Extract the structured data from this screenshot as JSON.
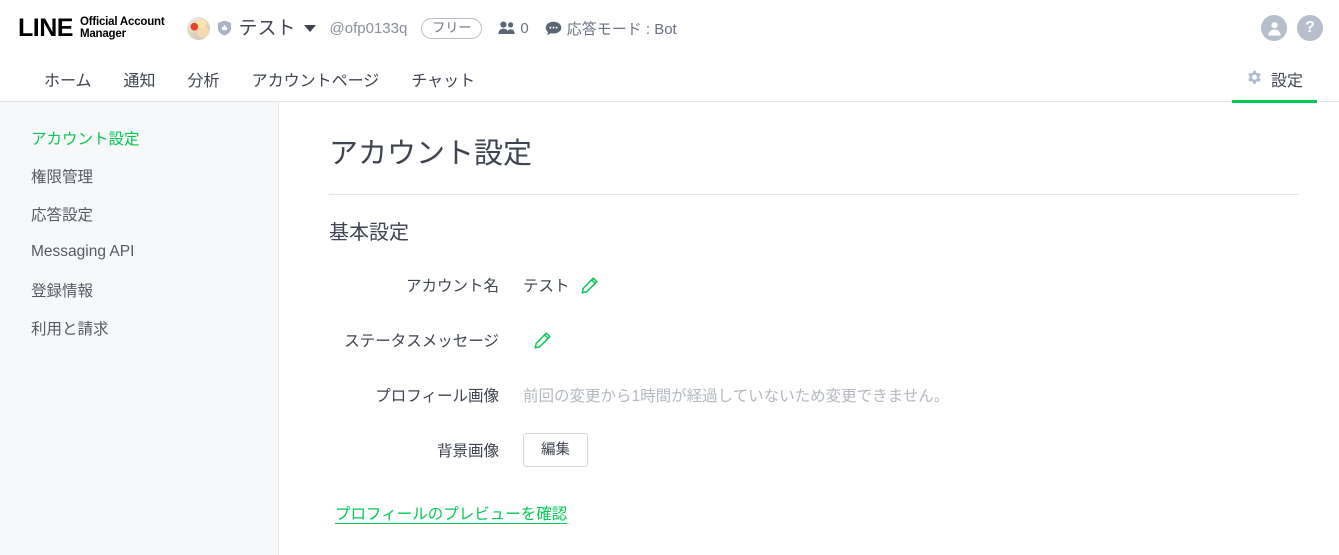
{
  "header": {
    "logo_primary": "LINE",
    "logo_secondary_line1": "Official Account",
    "logo_secondary_line2": "Manager",
    "avatar_icon": "account-avatar-image",
    "verified_badge_icon": "shield-badge-icon",
    "account_name": "テスト",
    "account_dropdown_icon": "chevron-down-icon",
    "account_id": "@ofp0133q",
    "plan_badge": "フリー",
    "friends_icon": "friends-icon",
    "friends_count": "0",
    "mode_icon": "chat-bubble-icon",
    "mode_text": "応答モード : Bot",
    "user_icon": "person-circle-icon",
    "help_icon": "help-circle-icon",
    "help_glyph": "?"
  },
  "nav": {
    "tabs": [
      {
        "label": "ホーム",
        "active": false
      },
      {
        "label": "通知",
        "active": false
      },
      {
        "label": "分析",
        "active": false
      },
      {
        "label": "アカウントページ",
        "active": false
      },
      {
        "label": "チャット",
        "active": false
      }
    ],
    "settings_tab": {
      "label": "設定",
      "icon": "gear-icon",
      "active": true
    },
    "active_accent_color": "#06c755"
  },
  "sidebar": {
    "items": [
      {
        "label": "アカウント設定",
        "active": true
      },
      {
        "label": "権限管理",
        "active": false
      },
      {
        "label": "応答設定",
        "active": false
      },
      {
        "label": "Messaging API",
        "active": false
      },
      {
        "label": "登録情報",
        "active": false
      },
      {
        "label": "利用と請求",
        "active": false
      }
    ]
  },
  "main": {
    "page_title": "アカウント設定",
    "section_title": "基本設定",
    "rows": [
      {
        "label": "アカウント名",
        "value": "テスト",
        "has_pencil": true,
        "muted": false,
        "button": null
      },
      {
        "label": "ステータスメッセージ",
        "value": "",
        "has_pencil": true,
        "muted": false,
        "button": null
      },
      {
        "label": "プロフィール画像",
        "value": "前回の変更から1時間が経過していないため変更できません。",
        "has_pencil": false,
        "muted": true,
        "button": null
      },
      {
        "label": "背景画像",
        "value": "",
        "has_pencil": false,
        "muted": false,
        "button": "編集"
      }
    ],
    "preview_link": "プロフィールのプレビューを確認"
  },
  "colors": {
    "accent_green": "#06c755",
    "text_primary": "#3e4450",
    "text_muted": "#b4b9c1",
    "sidebar_bg": "#f7f8fa",
    "border": "#e3e6ea"
  }
}
